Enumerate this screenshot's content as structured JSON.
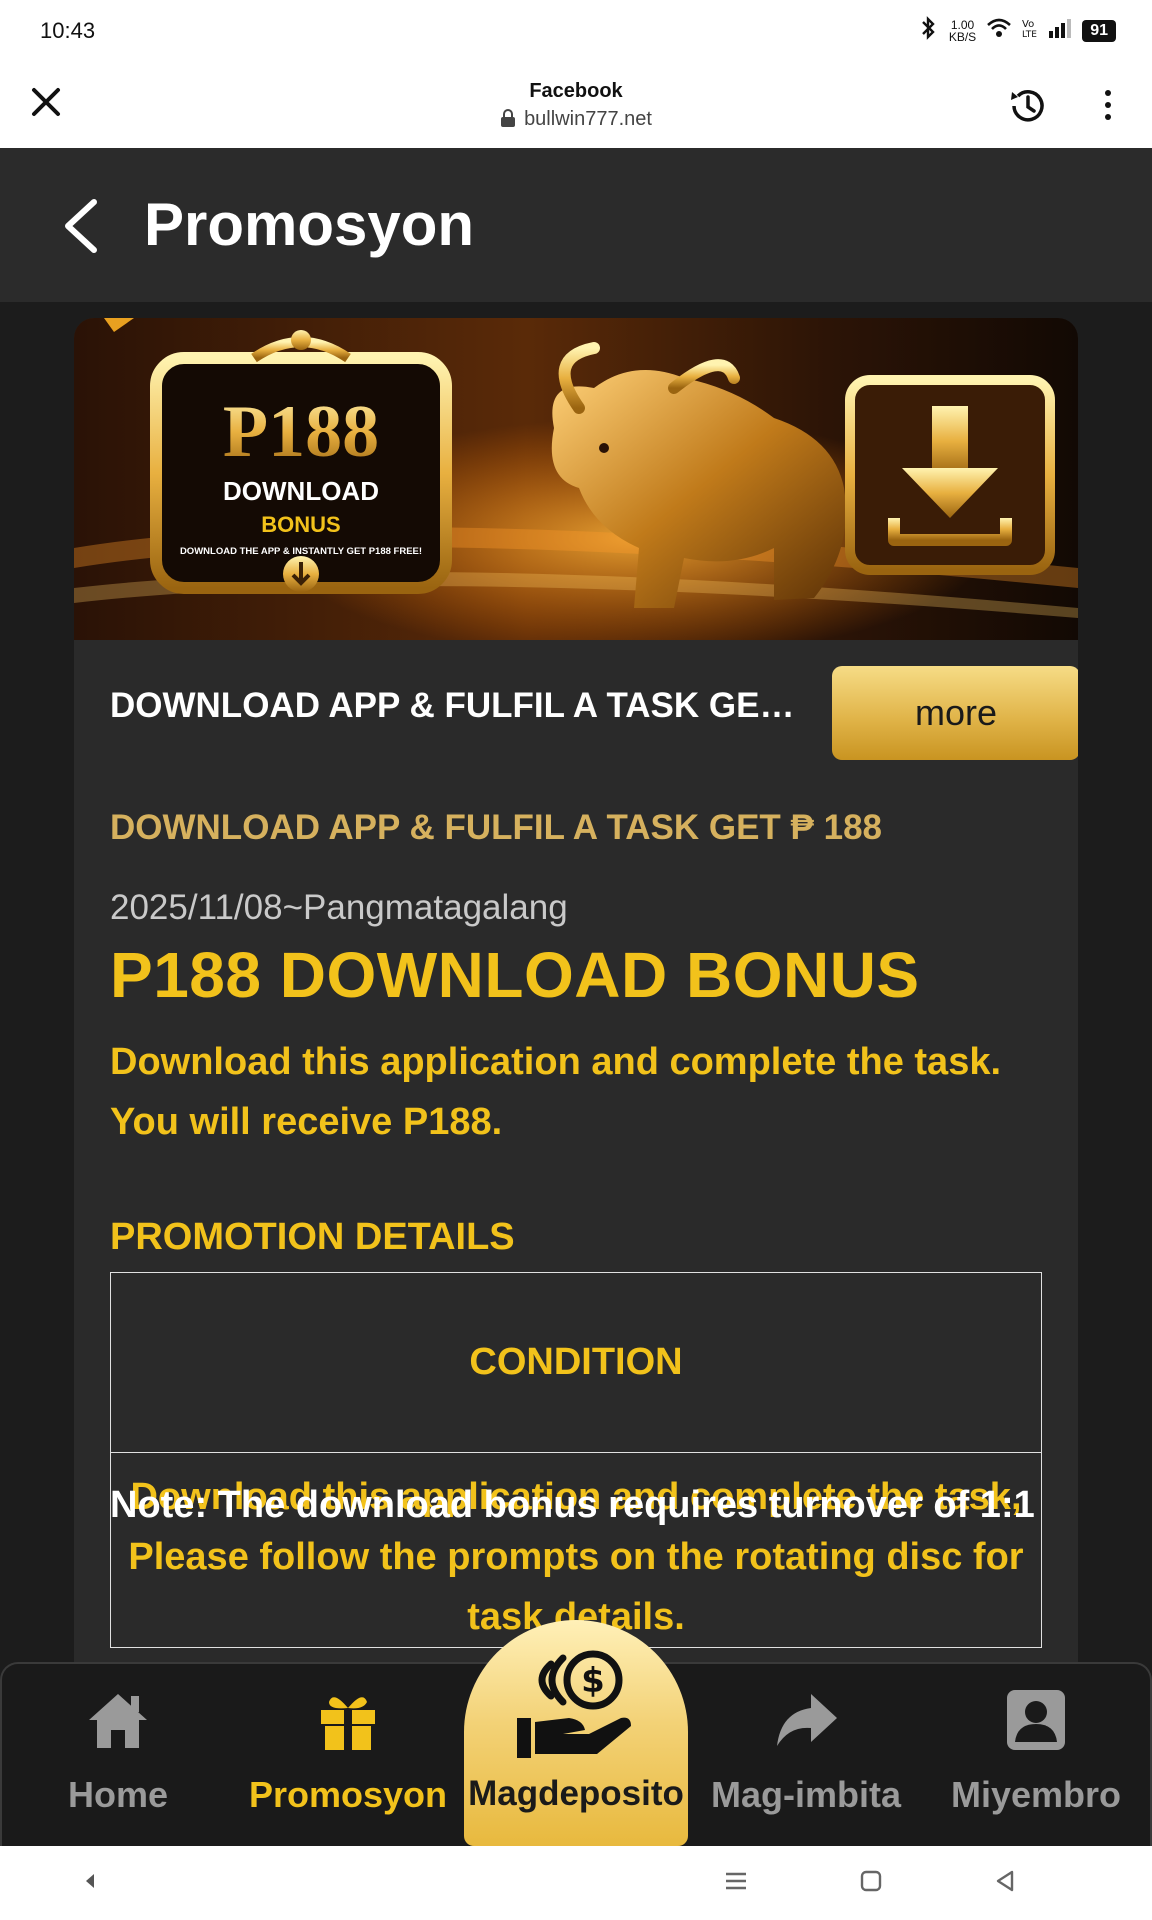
{
  "status_bar": {
    "time": "10:43",
    "net_speed_value": "1.00",
    "net_speed_unit": "KB/S",
    "battery": "91"
  },
  "browser": {
    "title": "Facebook",
    "url": "bullwin777.net",
    "icons": [
      "close-icon",
      "lock-icon",
      "history-icon",
      "more-vert-icon"
    ]
  },
  "header": {
    "title": "Promosyon",
    "back_icon": "chevron-left-icon"
  },
  "banner": {
    "amount": "P188",
    "line1": "DOWNLOAD",
    "line2": "BONUS",
    "tagline": "DOWNLOAD THE APP & INSTANTLY GET P188 FREE!"
  },
  "promo": {
    "summary": "DOWNLOAD APP & FULFIL A TASK GET ₱ 188",
    "more_label": "more",
    "subtitle": "DOWNLOAD APP & FULFIL A TASK GET ₱ 188",
    "date_range": "2025/11/08~Pangmatagalang",
    "bonus_title": "P188 DOWNLOAD BONUS",
    "description": "Download this application and complete the task. You will receive P188.",
    "details_heading": "PROMOTION DETAILS",
    "table_header": "CONDITION",
    "table_cell": "Download this application and complete the task, Please follow the prompts on the rotating disc for task details.",
    "note": "Note: The download bonus requires turnover of 1:1"
  },
  "bottom_nav": {
    "items": [
      {
        "label": "Home",
        "icon": "home-icon"
      },
      {
        "label": "Promosyon",
        "icon": "gift-icon"
      },
      {
        "label": "Magdeposito",
        "icon": "deposit-hand-icon"
      },
      {
        "label": "Mag-imbita",
        "icon": "share-icon"
      },
      {
        "label": "Miyembro",
        "icon": "member-icon"
      }
    ],
    "active_color": "#f2c21b",
    "inactive_color": "#9a9a9a"
  },
  "colors": {
    "accent_gold": "#f2c21b",
    "muted_gold": "#d6b15e",
    "page_bg": "#1c1c1c",
    "card_bg": "#2a2a2a",
    "header_bg": "#2b2b2b"
  }
}
